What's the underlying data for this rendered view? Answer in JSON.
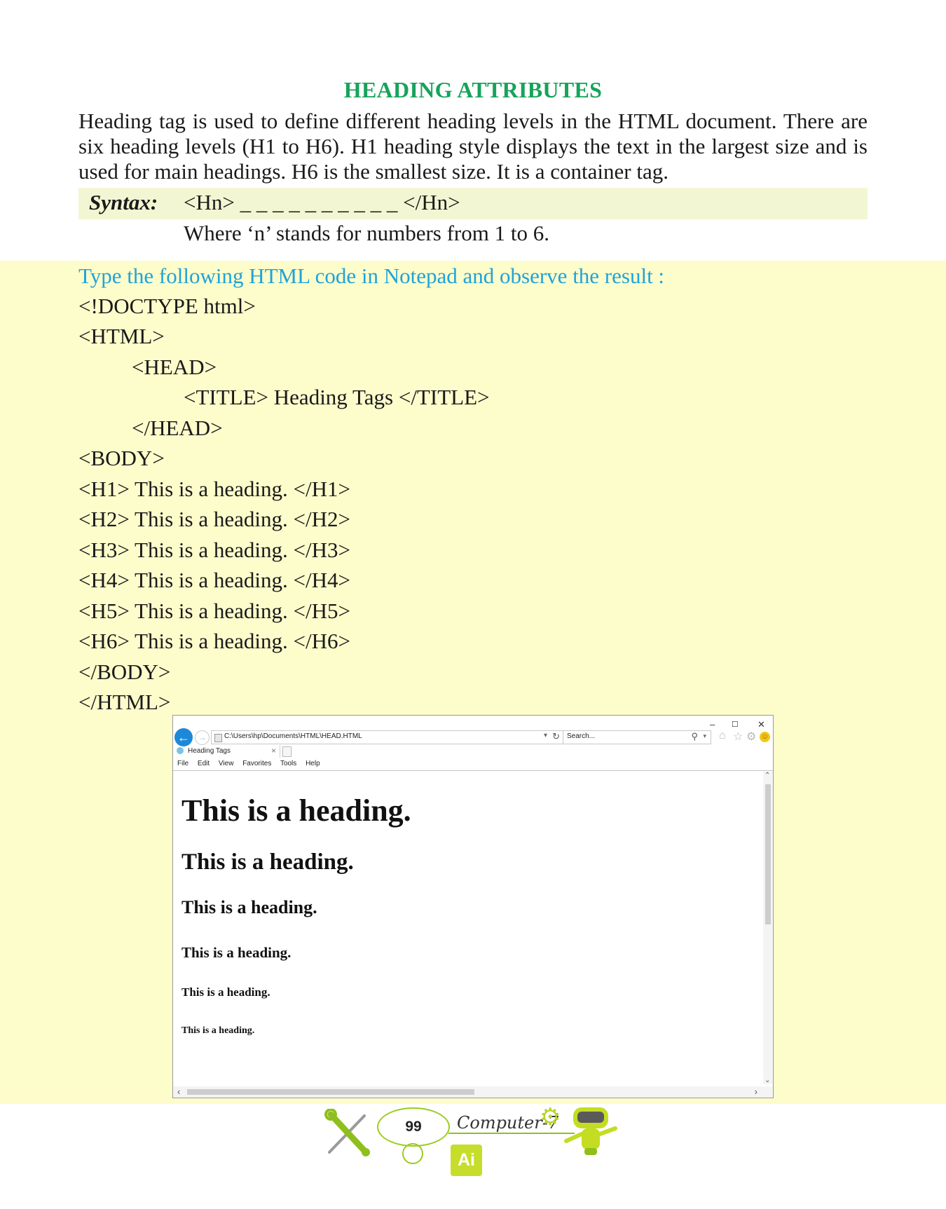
{
  "section": {
    "title": "HEADING ATTRIBUTES",
    "intro": "Heading tag is used to define different heading levels in the HTML document. There are six heading levels (H1 to H6). H1 heading style displays the text in the largest size and is used for main headings. H6 is the smallest size. It is a container tag."
  },
  "syntax": {
    "label": "Syntax:",
    "code": "<Hn> _ _ _ _ _ _ _ _ _ _ </Hn>",
    "note": "Where ‘n’ stands for numbers from 1 to 6."
  },
  "exercise": {
    "instruction": "Type the following HTML code in Notepad and observe the result :",
    "code_lines": [
      "<!DOCTYPE html>",
      "<HTML>",
      "<HEAD>",
      "<TITLE> Heading Tags </TITLE>",
      "</HEAD>",
      "<BODY>",
      "<H1> This is a heading. </H1>",
      "<H2> This is a heading. </H2>",
      "<H3> This is a heading. </H3>",
      "<H4> This is a heading. </H4>",
      "<H5> This is a heading. </H5>",
      "<H6> This is a heading. </H6>",
      "</BODY>",
      "</HTML>"
    ]
  },
  "browser": {
    "window_controls": {
      "minimize": "–",
      "maximize": "☐",
      "close": "✕"
    },
    "address": "C:\\Users\\hp\\Documents\\HTML\\HEAD.HTML",
    "search_placeholder": "Search...",
    "tab_title": "Heading Tags",
    "menu": [
      "File",
      "Edit",
      "View",
      "Favorites",
      "Tools",
      "Help"
    ],
    "headings": [
      "This is a heading.",
      "This is a heading.",
      "This is a heading.",
      "This is a heading.",
      "This is a heading.",
      "This is a heading."
    ],
    "icons": [
      "back-icon",
      "forward-icon",
      "refresh-icon",
      "search-icon",
      "home-icon",
      "star-icon",
      "gear-icon",
      "smiley-icon"
    ]
  },
  "footer": {
    "page_number": "99",
    "book_title": "Computer-7",
    "badge": "Ai"
  },
  "colors": {
    "title_green": "#17a35a",
    "instruction_blue": "#1fa3d9",
    "syntax_band": "#f3f6d2",
    "code_background": "#fdfccb",
    "accent_lime": "#9bcc1d"
  }
}
